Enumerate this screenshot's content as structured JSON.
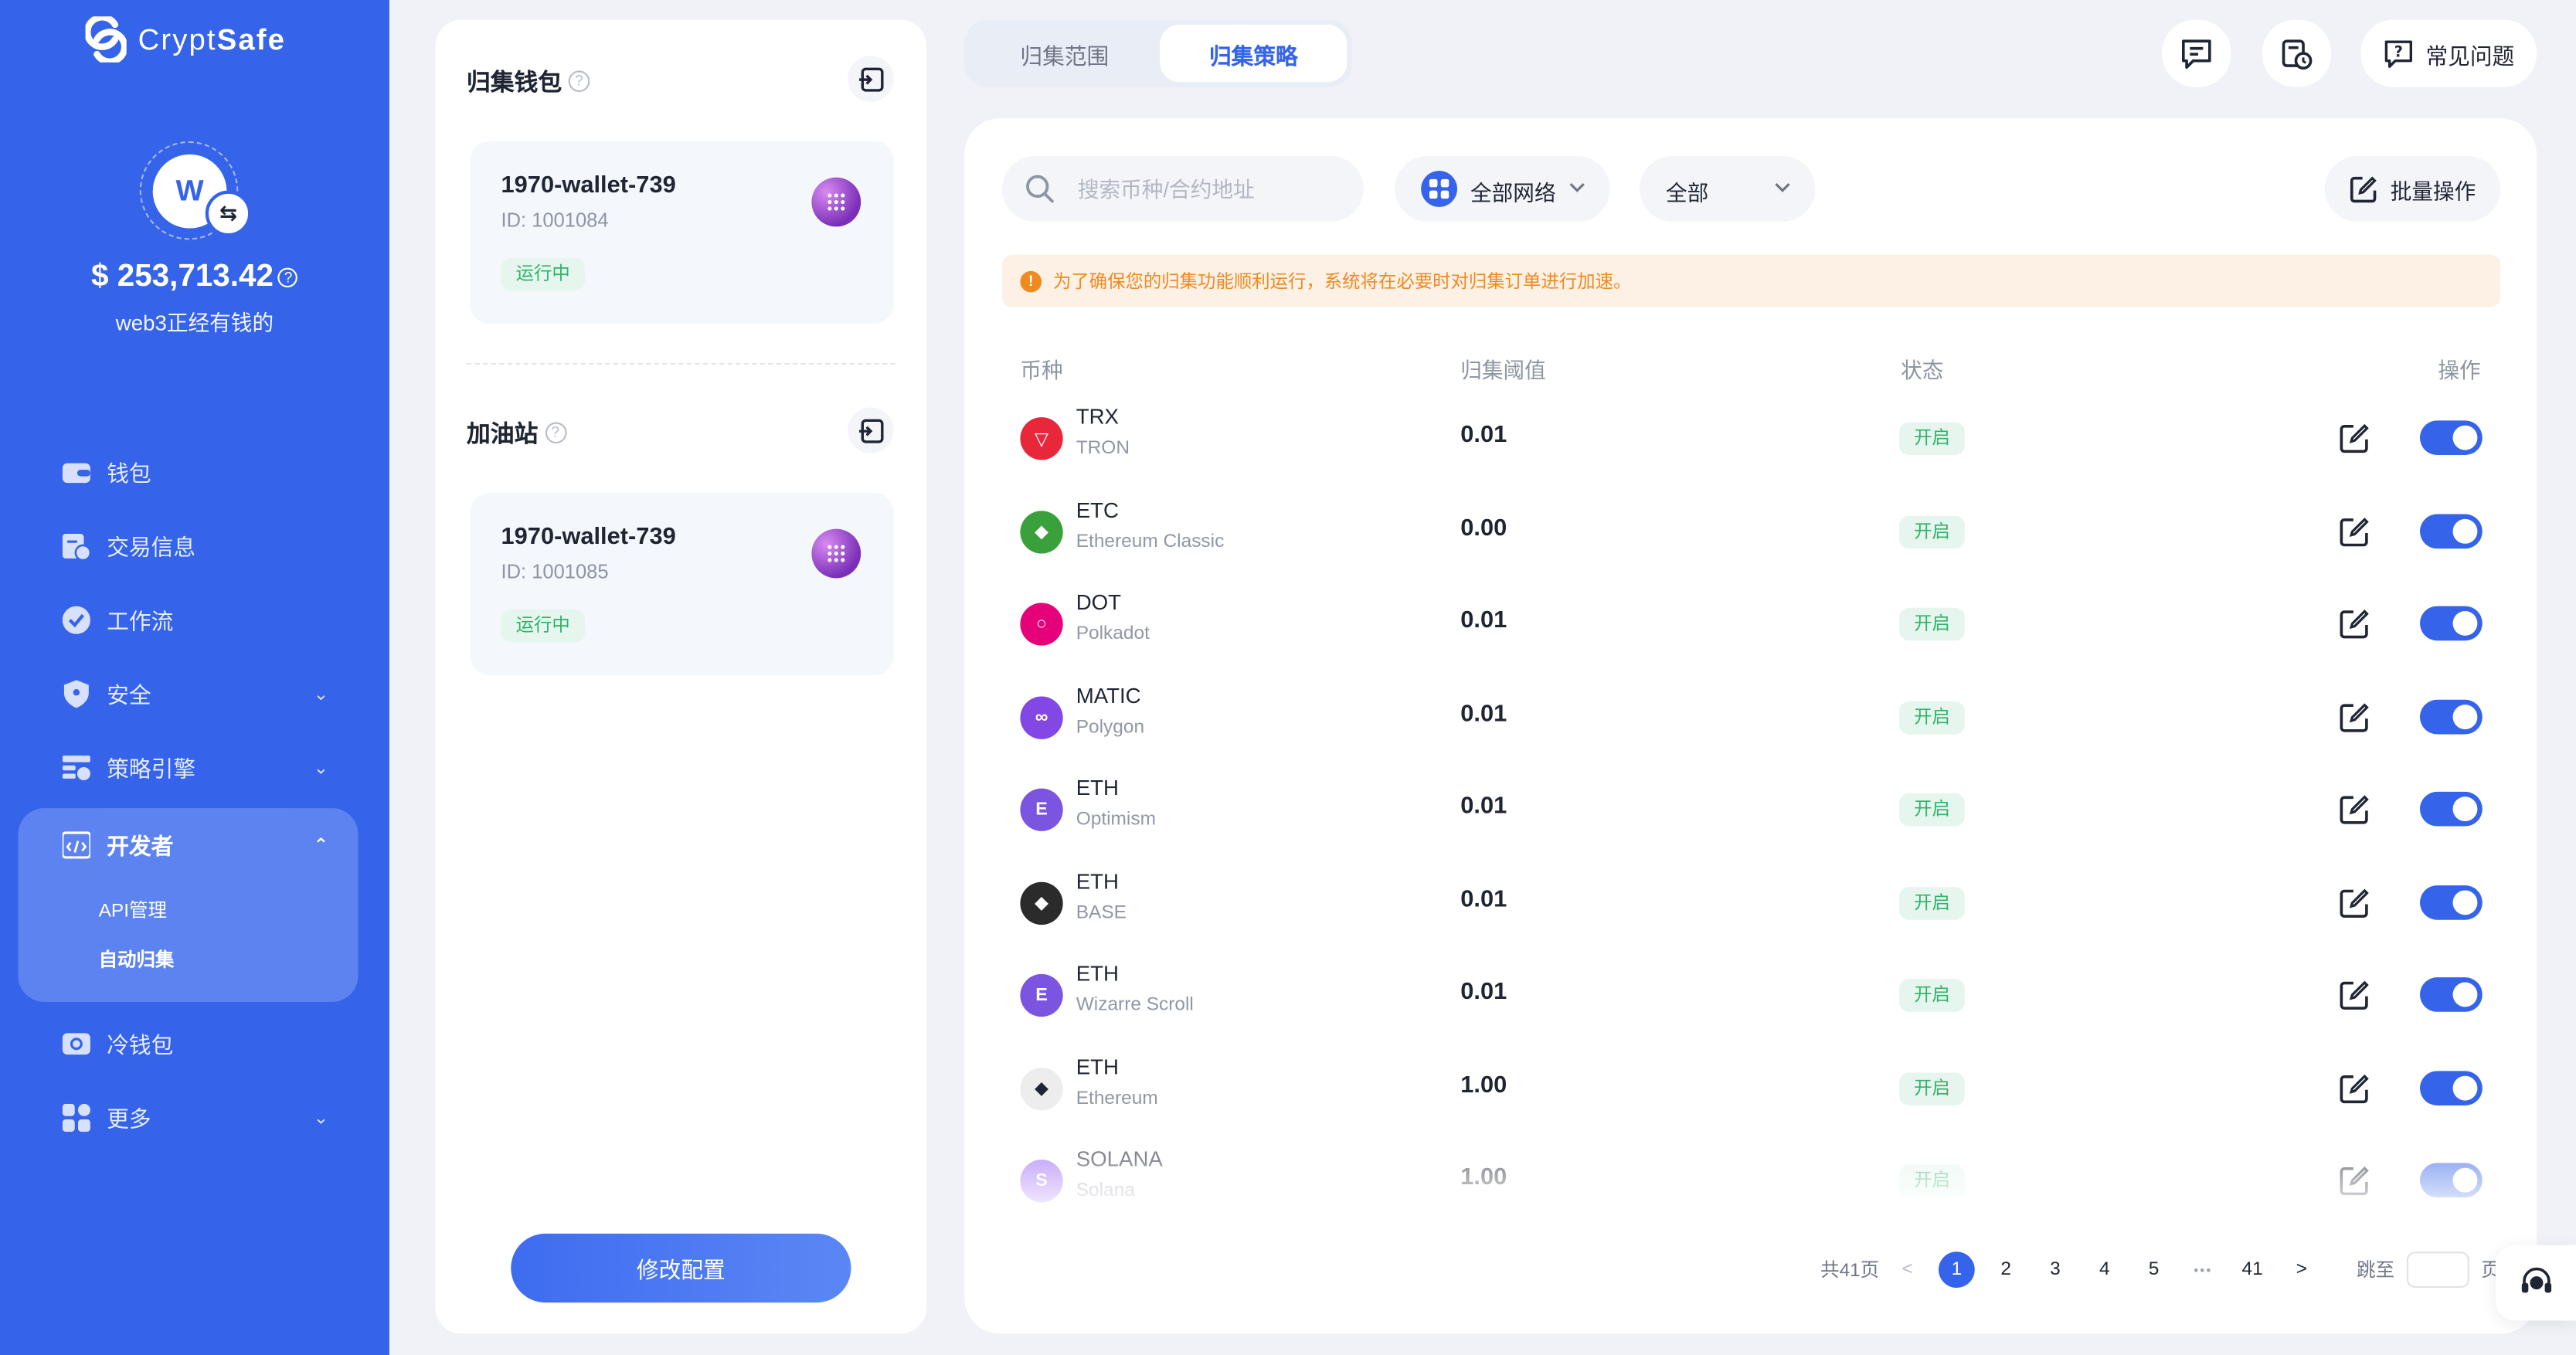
{
  "brand": {
    "name_prefix": "Crypt",
    "name_suffix": "Safe"
  },
  "user": {
    "avatar_letter": "W",
    "swap_glyph": "⇆",
    "balance": "$ 253,713.42",
    "subtitle": "web3正经有钱的"
  },
  "sidebar": {
    "items": [
      {
        "label": "钱包",
        "icon": "wallet-icon"
      },
      {
        "label": "交易信息",
        "icon": "transaction-icon"
      },
      {
        "label": "工作流",
        "icon": "workflow-icon"
      },
      {
        "label": "安全",
        "icon": "shield-icon",
        "expandable": true
      },
      {
        "label": "策略引擎",
        "icon": "strategy-icon",
        "expandable": true
      },
      {
        "label": "开发者",
        "icon": "code-icon",
        "expanded": true,
        "children": [
          "API管理",
          "自动归集"
        ]
      },
      {
        "label": "冷钱包",
        "icon": "cold-wallet-icon"
      },
      {
        "label": "更多",
        "icon": "grid-icon",
        "expandable": true
      }
    ],
    "active_child": "自动归集"
  },
  "left_panel": {
    "collect_wallet": {
      "title": "归集钱包",
      "name": "1970-wallet-739",
      "id": "ID: 1001084",
      "status": "运行中"
    },
    "gas_station": {
      "title": "加油站",
      "name": "1970-wallet-739",
      "id": "ID: 1001085",
      "status": "运行中"
    },
    "modify_button": "修改配置"
  },
  "tabs": {
    "scope": "归集范围",
    "strategy": "归集策略",
    "active": "归集策略"
  },
  "header": {
    "faq_label": "常见问题",
    "faq_glyph": "?"
  },
  "filters": {
    "search_placeholder": "搜索币种/合约地址",
    "network": "全部网络",
    "status": "全部",
    "bulk": "批量操作"
  },
  "notice": {
    "glyph": "!",
    "text": "为了确保您的归集功能顺利运行，系统将在必要时对归集订单进行加速。"
  },
  "table": {
    "headers": {
      "coin": "币种",
      "threshold": "归集阈值",
      "status": "状态",
      "actions": "操作"
    },
    "rows": [
      {
        "symbol": "TRX",
        "network": "TRON",
        "threshold": "0.01",
        "status": "开启",
        "enabled": true,
        "icon_color": "#e8283a",
        "icon_glyph": "▽"
      },
      {
        "symbol": "ETC",
        "network": "Ethereum Classic",
        "threshold": "0.00",
        "status": "开启",
        "enabled": true,
        "icon_color": "#3aa03c",
        "icon_glyph": "◆"
      },
      {
        "symbol": "DOT",
        "network": "Polkadot",
        "threshold": "0.01",
        "status": "开启",
        "enabled": true,
        "icon_color": "#e6007a",
        "icon_glyph": "○"
      },
      {
        "symbol": "MATIC",
        "network": "Polygon",
        "threshold": "0.01",
        "status": "开启",
        "enabled": true,
        "icon_color": "#8247e5",
        "icon_glyph": "∞"
      },
      {
        "symbol": "ETH",
        "network": "Optimism",
        "threshold": "0.01",
        "status": "开启",
        "enabled": true,
        "icon_color": "#7b55e0",
        "icon_glyph": "E"
      },
      {
        "symbol": "ETH",
        "network": "BASE",
        "threshold": "0.01",
        "status": "开启",
        "enabled": true,
        "icon_color": "#2b2b2b",
        "icon_glyph": "◆"
      },
      {
        "symbol": "ETH",
        "network": "Wizarre Scroll",
        "threshold": "0.01",
        "status": "开启",
        "enabled": true,
        "icon_color": "#7b55e0",
        "icon_glyph": "E"
      },
      {
        "symbol": "ETH",
        "network": "Ethereum",
        "threshold": "1.00",
        "status": "开启",
        "enabled": true,
        "icon_color": "#ededed",
        "icon_glyph": "◆"
      },
      {
        "symbol": "SOLANA",
        "network": "Solana",
        "threshold": "1.00",
        "status": "开启",
        "enabled": true,
        "icon_color": "#9a63f5",
        "icon_glyph": "S"
      }
    ]
  },
  "pagination": {
    "total_label": "共41页",
    "prev": "<",
    "pages": [
      "1",
      "2",
      "3",
      "4",
      "5"
    ],
    "ellipsis": "•••",
    "last": "41",
    "next": ">",
    "current": "1",
    "jump_label": "跳至",
    "page_suffix": "页"
  },
  "colors": {
    "primary": "#3563e9",
    "success": "#2fb36a",
    "warning": "#ef8a1f"
  }
}
